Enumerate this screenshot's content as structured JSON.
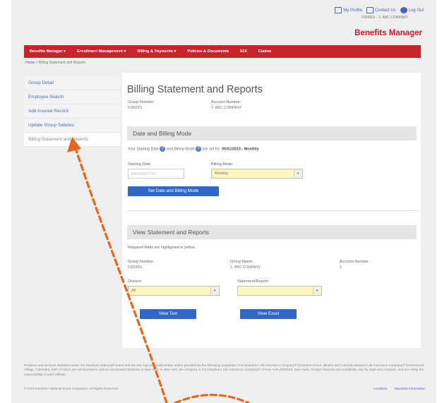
{
  "header": {
    "links": [
      "My Profile",
      "Contact Us",
      "Log Out"
    ],
    "account_line": "F000001 - 1: ABC COMPANY",
    "brand": "Benefits Manager"
  },
  "nav": {
    "items": [
      "Benefits Manager ▾",
      "Enrollment Management ▾",
      "Billing & Payments ▾",
      "Policies & Documents",
      "EOI",
      "Claims"
    ]
  },
  "breadcrumb": {
    "home": "Home",
    "sep": " > ",
    "current": "Billing Statement and Reports"
  },
  "sidebar": {
    "items": [
      "Group Detail",
      "Employee Search",
      "Add Insured Record",
      "Update Group Salaries",
      "Billing Statement and Reports"
    ]
  },
  "main": {
    "title": "Billing Statement and Reports",
    "group_number_label": "Group Number:",
    "group_number_value": "F000001",
    "account_number_label": "Account Number:",
    "account_number_value": "1: ABC COMPANY",
    "date_section": {
      "title": "Date and Billing Mode",
      "note_start": "Your Starting Date",
      "note_mid": "and Billing Mode",
      "note_mid2": "are set for:",
      "note_date": "05/01/2015",
      "note_dash": " - ",
      "note_mode": "Monthly",
      "starting_date_label": "Starting Date:",
      "starting_date_placeholder": "MM/DD/YYYY",
      "billing_mode_label": "Billing Mode:",
      "billing_mode_value": "Monthly",
      "set_button": "Set Date and Billing Mode"
    },
    "view_section": {
      "title": "View Statement and Reports",
      "required_note": "Required fields are highlighted in yellow.",
      "group_number_label": "Group Number",
      "group_number_value": "F000001",
      "group_name_label": "Group Name",
      "group_name_value": "1: ABC COMPANY",
      "account_number_label": "Account Number",
      "account_number_value": "1",
      "division_label": "Division:",
      "division_value": "All",
      "statement_label": "Statement/Report:",
      "statement_value": "",
      "view_text_button": "View Text",
      "view_excel_button": "View Excel"
    }
  },
  "footer": {
    "disclaimer": "Products and services marketed under the Dearborn National® brand and the star logo are underwritten and/or provided by the following companies: Fort Dearborn Life Insurance Company® (Downers Grove, Illinois) and Colorado Bankers Life Insurance Company® (Greenwood Village, Colorado), both of which are not licensed in and do not transact business in New York; in New York, the company is Fort Dearborn Life Insurance Company® of New York (Pittsford, New York). Product features and availability vary by state and company, and are solely the responsibility of each affiliate.",
    "copyright": "© 2012 Dearborn National brand companies. All Rights Reserved.",
    "links": [
      "Locations",
      "Important Information"
    ]
  },
  "colors": {
    "nav_red": "#c8242c",
    "brand_red": "#c8202a",
    "link_blue": "#4a63c8",
    "button_blue": "#2f68c7",
    "required_yellow": "#fdf6bd",
    "annotation_orange": "#e8661a"
  }
}
